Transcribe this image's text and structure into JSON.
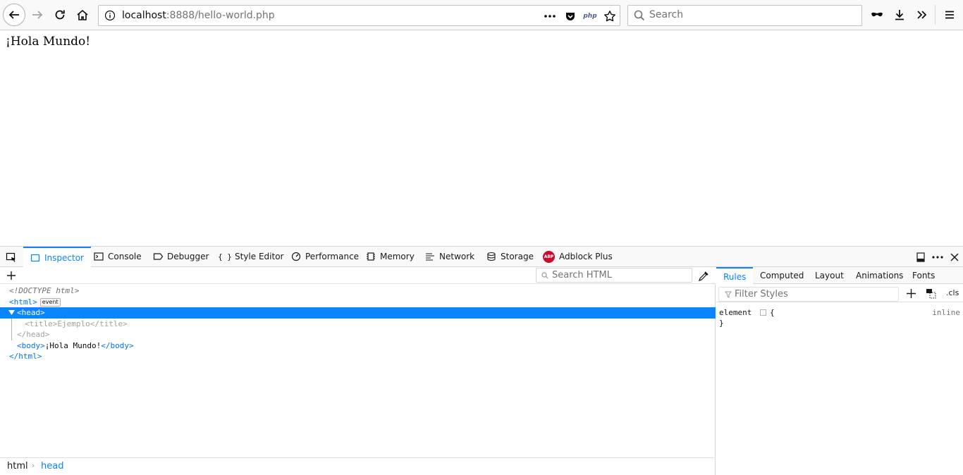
{
  "browser": {
    "url_host": "localhost",
    "url_path": ":8888/hello-world.php",
    "page_action_php": "php",
    "search_placeholder": "Search"
  },
  "page": {
    "text": "¡Hola Mundo!"
  },
  "devtools": {
    "tabs": [
      {
        "label": "Inspector"
      },
      {
        "label": "Console"
      },
      {
        "label": "Debugger"
      },
      {
        "label": "Style Editor"
      },
      {
        "label": "Performance"
      },
      {
        "label": "Memory"
      },
      {
        "label": "Network"
      },
      {
        "label": "Storage"
      },
      {
        "label": "Adblock Plus"
      }
    ],
    "abp_logo": "ABP",
    "search_html_placeholder": "Search HTML",
    "markup": {
      "doctype": "<!DOCTYPE html>",
      "html_open": "<html>",
      "event_badge": "event",
      "head_open": "<head>",
      "title_line": "<title>Ejemplo</title>",
      "head_close": "</head>",
      "body_open": "<body>",
      "body_text": "¡Hola Mundo!",
      "body_close": "</body>",
      "html_close": "</html>"
    },
    "breadcrumbs": [
      "html",
      "head"
    ],
    "sidebar": {
      "tabs": [
        "Rules",
        "Computed",
        "Layout",
        "Animations",
        "Fonts"
      ],
      "filter_placeholder": "Filter Styles",
      "cls_label": ".cls",
      "rule_selector": "element",
      "rule_open": "{",
      "rule_close": "}",
      "rule_source": "inline"
    }
  },
  "colors": {
    "accent": "#0a84ff",
    "tag": "#0074e8"
  }
}
